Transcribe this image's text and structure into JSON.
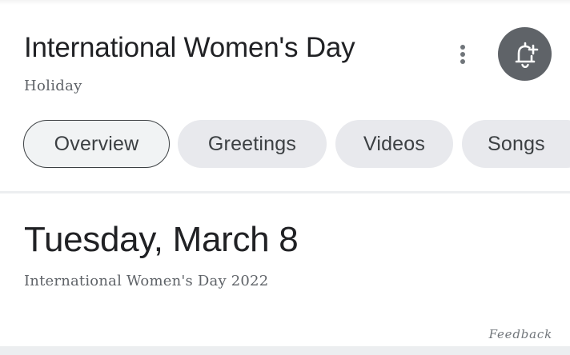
{
  "header": {
    "title": "International Women's Day",
    "subtitle": "Holiday",
    "more_icon": "more-vert-icon",
    "reminder_icon": "add-alert-bell-icon"
  },
  "tabs": [
    {
      "label": "Overview",
      "active": true
    },
    {
      "label": "Greetings",
      "active": false
    },
    {
      "label": "Videos",
      "active": false
    },
    {
      "label": "Songs",
      "active": false
    }
  ],
  "event": {
    "date": "Tuesday, March 8",
    "description": "International Women's Day 2022"
  },
  "footer": {
    "feedback_label": "Feedback"
  },
  "colors": {
    "primary_text": "#202124",
    "secondary_text": "#5f6368",
    "reminder_button_bg": "#5f6368",
    "chip_bg": "#e8e9ed",
    "active_chip_border": "#3c4043"
  }
}
